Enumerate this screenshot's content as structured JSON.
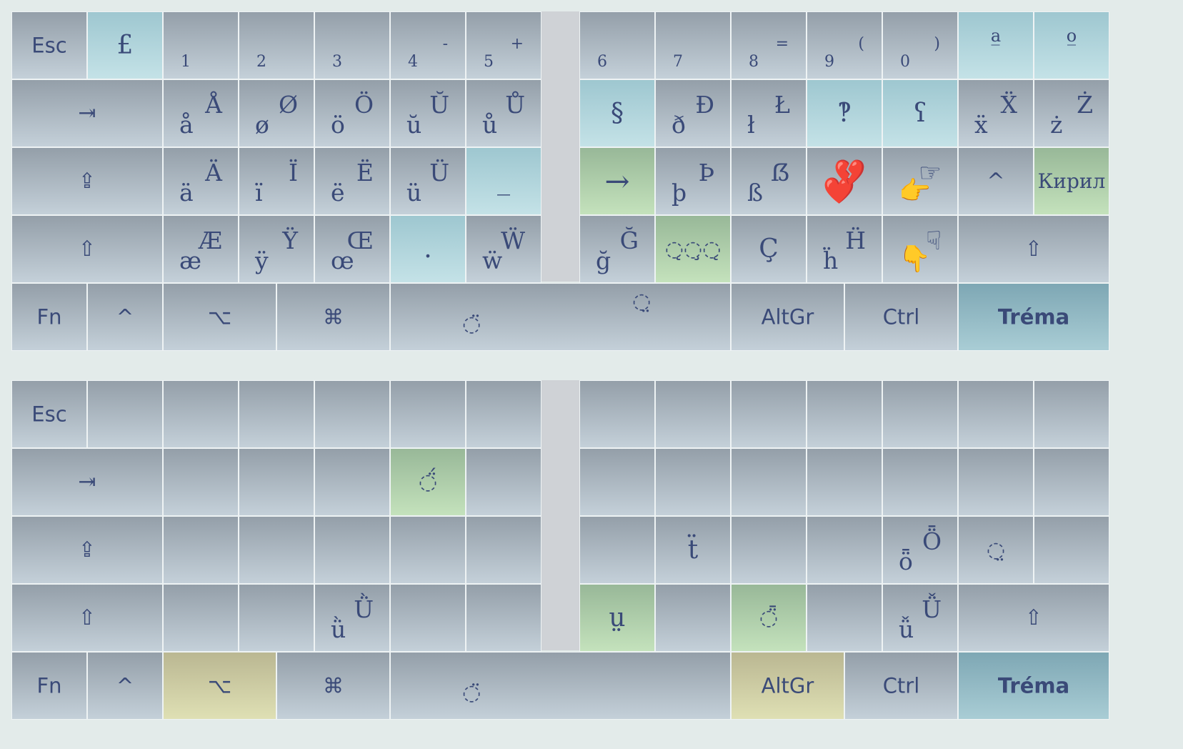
{
  "top": {
    "row1": {
      "esc": "Esc",
      "pound": "£",
      "n1": "1",
      "n2": "2",
      "n3": "3",
      "n4": "4",
      "n4_up": "-",
      "n5": "5",
      "n5_up": "+",
      "n6": "6",
      "n7": "7",
      "n8": "8",
      "n8_up": "=",
      "n9": "9",
      "n9_up": "(",
      "n0": "0",
      "n0_up": ")",
      "ord_a": "a̲",
      "ord_o": "o̲"
    },
    "row2": {
      "tab": "⇥",
      "k1_lo": "å",
      "k1_up": "Å",
      "k2_lo": "ø",
      "k2_up": "Ø",
      "k3_lo": "ö",
      "k3_up": "Ö",
      "k4_lo": "ŭ",
      "k4_up": "Ŭ",
      "k5_lo": "ů",
      "k5_up": "Ů",
      "section": "§",
      "k7_lo": "ð",
      "k7_up": "Đ",
      "k8_lo": "ł",
      "k8_up": "Ł",
      "k9": "‽",
      "k10": "ʕ",
      "k11_lo": "ẍ",
      "k11_up": "Ẍ",
      "k12_lo": "ż",
      "k12_up": "Ż"
    },
    "row3": {
      "caps": "⇪",
      "k1_lo": "ä",
      "k1_up": "Ä",
      "k2_lo": "ï",
      "k2_up": "Ï",
      "k3_lo": "ë",
      "k3_up": "Ë",
      "k4_lo": "ü",
      "k4_up": "Ü",
      "k5": "_",
      "arrow": "→",
      "k7_lo": "þ",
      "k7_up": "Þ",
      "k8_lo": "ß",
      "k8_up": "ẞ",
      "k9_lo": "❤️",
      "k9_up": "💔",
      "k10_lo": "👉",
      "k10_up": "☞",
      "k11": "^",
      "cyril": "Кирил"
    },
    "row4": {
      "shift_l": "⇧",
      "k1_lo": "æ",
      "k1_up": "Æ",
      "k2_lo": "ÿ",
      "k2_up": "Ÿ",
      "k3_lo": "œ",
      "k3_up": "Œ",
      "k4": ".",
      "k5_lo": "ẅ",
      "k5_up": "Ẅ",
      "k6_lo": "ğ",
      "k6_up": "Ğ",
      "k7": "◌̨◌̧◌̨",
      "k8": "Ç",
      "k9_lo": "ḧ",
      "k9_up": "Ḧ",
      "k10_lo": "👇",
      "k10_up": "☟",
      "shift_r": "⇧"
    },
    "row5": {
      "fn": "Fn",
      "ctrl_sym": "^",
      "opt": "⌥",
      "cmd": "⌘",
      "space_mark": "◌̈",
      "space_mark2": "◌̤",
      "altgr": "AltGr",
      "ctrl": "Ctrl",
      "trema": "Tréma"
    }
  },
  "bottom": {
    "row1": {
      "esc": "Esc"
    },
    "row2": {
      "tab": "⇥",
      "k5": "◌̈́"
    },
    "row3": {
      "caps": "⇪",
      "k7": "ẗ",
      "k10_lo": "ȫ",
      "k10_up": "Ȫ",
      "k11": "◌̤"
    },
    "row4": {
      "shift_l": "⇧",
      "k3_lo": "ǜ",
      "k3_up": "Ǜ",
      "k6": "ṳ",
      "k8": "◌̈̄",
      "k10_lo": "ǚ",
      "k10_up": "Ǚ",
      "shift_r": "⇧"
    },
    "row5": {
      "fn": "Fn",
      "ctrl_sym": "^",
      "opt": "⌥",
      "cmd": "⌘",
      "space_mark": "◌̈",
      "altgr": "AltGr",
      "ctrl": "Ctrl",
      "trema": "Tréma"
    }
  }
}
